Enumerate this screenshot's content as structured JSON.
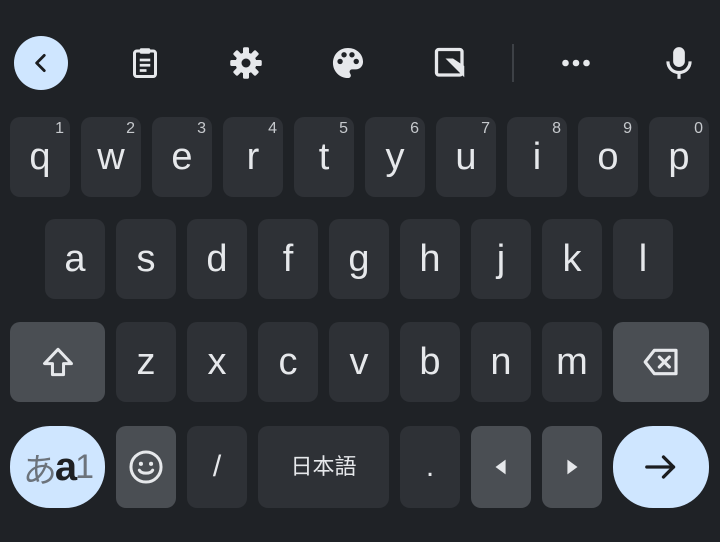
{
  "toolbar": {
    "icons": [
      "chevron-left-icon",
      "clipboard-icon",
      "gear-icon",
      "palette-icon",
      "edit-box-icon",
      "more-horizontal-icon",
      "microphone-icon"
    ]
  },
  "keyboard": {
    "row1": [
      {
        "letter": "q",
        "hint": "1"
      },
      {
        "letter": "w",
        "hint": "2"
      },
      {
        "letter": "e",
        "hint": "3"
      },
      {
        "letter": "r",
        "hint": "4"
      },
      {
        "letter": "t",
        "hint": "5"
      },
      {
        "letter": "y",
        "hint": "6"
      },
      {
        "letter": "u",
        "hint": "7"
      },
      {
        "letter": "i",
        "hint": "8"
      },
      {
        "letter": "o",
        "hint": "9"
      },
      {
        "letter": "p",
        "hint": "0"
      }
    ],
    "row2": [
      "a",
      "s",
      "d",
      "f",
      "g",
      "h",
      "j",
      "k",
      "l"
    ],
    "row3": [
      "z",
      "x",
      "c",
      "v",
      "b",
      "n",
      "m"
    ],
    "bottom": {
      "lang_switch": {
        "part1": "あ",
        "part2": "a",
        "part3": "1"
      },
      "slash": "/",
      "space_label": "日本語",
      "period": "."
    }
  },
  "colors": {
    "background": "#1f2226",
    "key": "#2e3136",
    "function_key": "#4a4e53",
    "accent": "#cfe6ff"
  }
}
